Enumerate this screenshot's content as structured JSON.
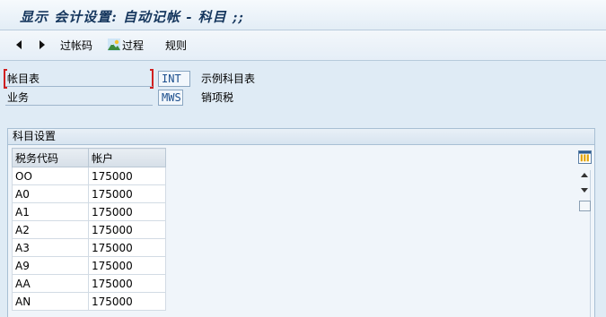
{
  "window": {
    "title": "显示 会计设置: 自动记帐 - 科目 ;;"
  },
  "toolbar": {
    "back_icon": "triangle-left",
    "forward_icon": "triangle-right",
    "posting_keys_label": "过帐码",
    "process_label": "过程",
    "process_icon": "mountain-landscape",
    "rules_label": "规则"
  },
  "fields": {
    "chart_of_accounts": {
      "label": "帐目表",
      "value": "INT",
      "description": "示例科目表"
    },
    "transaction": {
      "label": "业务",
      "value": "MWS",
      "description": "销项税"
    }
  },
  "section": {
    "title": "科目设置"
  },
  "table": {
    "headers": [
      "税务代码",
      "帐户"
    ],
    "rows": [
      [
        "OO",
        "175000"
      ],
      [
        "A0",
        "175000"
      ],
      [
        "A1",
        "175000"
      ],
      [
        "A2",
        "175000"
      ],
      [
        "A3",
        "175000"
      ],
      [
        "A9",
        "175000"
      ],
      [
        "AA",
        "175000"
      ],
      [
        "AN",
        "175000"
      ]
    ]
  },
  "colors": {
    "required_marker": "#d02020",
    "value_text": "#1a4d8c",
    "title_text": "#15365d"
  }
}
